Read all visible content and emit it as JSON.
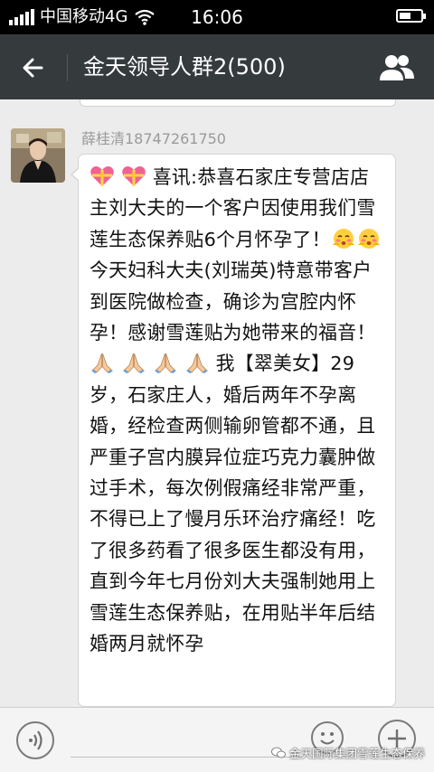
{
  "status_bar": {
    "carrier": "中国移动4G",
    "time": "16:06",
    "battery_level": 0.55
  },
  "header": {
    "title": "金天领导人群2(500)",
    "back_icon": "back-arrow-icon",
    "members_icon": "group-members-icon"
  },
  "message": {
    "sender": "薛桂清18747261750",
    "segments": [
      {
        "type": "emoji",
        "icon": "heart-gift-emoji"
      },
      {
        "type": "text",
        "text": "  "
      },
      {
        "type": "emoji",
        "icon": "heart-gift-emoji"
      },
      {
        "type": "text",
        "text": "  喜讯:恭喜石家庄专营店店主刘大夫的一个客户因使用我们雪莲生态保养贴6个月怀孕了！"
      },
      {
        "type": "emoji",
        "icon": "blushing-face-emoji"
      },
      {
        "type": "emoji",
        "icon": "blushing-face-emoji"
      },
      {
        "type": "text",
        "text": "今天妇科大夫(刘瑞英)特意带客户到医院做检查，确诊为宫腔内怀孕！感谢雪莲贴为她带来的福音！"
      },
      {
        "type": "emoji",
        "icon": "praying-hands-emoji"
      },
      {
        "type": "text",
        "text": " "
      },
      {
        "type": "emoji",
        "icon": "praying-hands-emoji"
      },
      {
        "type": "text",
        "text": "  "
      },
      {
        "type": "emoji",
        "icon": "praying-hands-emoji"
      },
      {
        "type": "text",
        "text": "  "
      },
      {
        "type": "emoji",
        "icon": "praying-hands-emoji"
      },
      {
        "type": "text",
        "text": "  我【翠美女】29岁，石家庄人，婚后两年不孕离婚，经检查两侧输卵管都不通，且严重子宫内膜异位症巧克力囊肿做过手术，每次例假痛经非常严重，不得已上了慢月乐环治疗痛经！吃了很多药看了很多医生都没有用，直到今年七月份刘大夫强制她用上雪莲生态保养贴，在用贴半年后结婚两月就怀孕"
      }
    ]
  },
  "input_bar": {
    "voice_icon": "voice-input-icon",
    "emoji_icon": "emoji-picker-icon",
    "plus_icon": "more-plus-icon"
  },
  "watermark": {
    "text": "金天国际集团雪莲生态保养"
  },
  "colors": {
    "header_bg": "#353a3d",
    "chat_bg": "#ececec",
    "bubble_bg": "#ffffff",
    "sender_text": "#9a9a9a"
  }
}
